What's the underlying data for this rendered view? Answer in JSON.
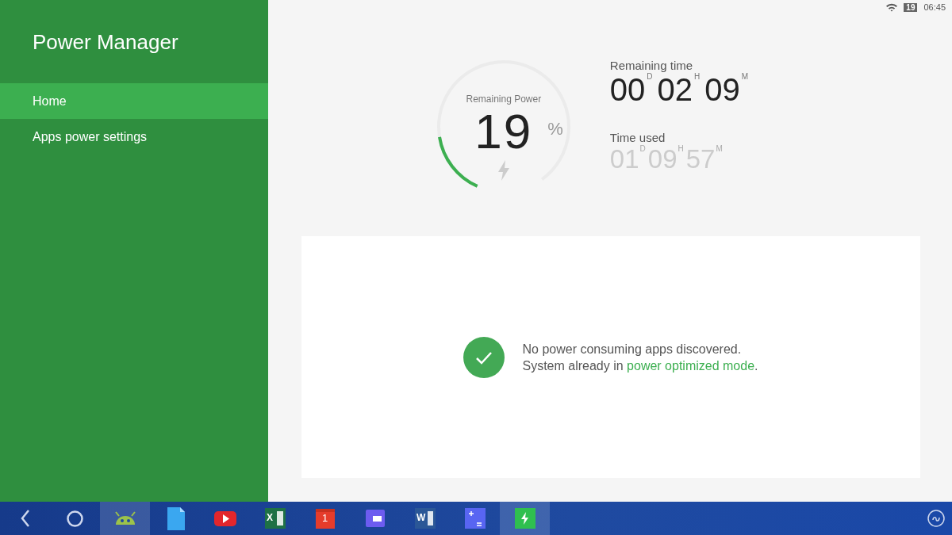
{
  "sidebar": {
    "title": "Power Manager",
    "items": [
      {
        "label": "Home",
        "selected": true
      },
      {
        "label": "Apps power settings",
        "selected": false
      }
    ]
  },
  "status_bar": {
    "battery": "19",
    "time": "06:45"
  },
  "gauge": {
    "label": "Remaining Power",
    "value": "19",
    "unit": "%",
    "level": 0.19
  },
  "remaining_time": {
    "label": "Remaining time",
    "parts": [
      {
        "value": "00",
        "unit": "D"
      },
      {
        "value": "02",
        "unit": "H"
      },
      {
        "value": "09",
        "unit": "M"
      }
    ]
  },
  "time_used": {
    "label": "Time used",
    "parts": [
      {
        "value": "01",
        "unit": "D"
      },
      {
        "value": "09",
        "unit": "H"
      },
      {
        "value": "57",
        "unit": "M"
      }
    ]
  },
  "message": {
    "line1": "No power consuming apps discovered.",
    "line2_before": "System already in ",
    "link": "power optimized mode",
    "line2_after": "."
  },
  "taskbar": {
    "items": [
      {
        "kind": "back",
        "selected": false
      },
      {
        "kind": "home",
        "selected": false
      },
      {
        "kind": "android",
        "selected": true
      },
      {
        "kind": "document",
        "selected": false
      },
      {
        "kind": "video",
        "selected": false
      },
      {
        "kind": "sheet",
        "label": "X",
        "selected": false
      },
      {
        "kind": "calendar",
        "label": "1",
        "selected": false
      },
      {
        "kind": "screen",
        "selected": false
      },
      {
        "kind": "word",
        "label": "W",
        "selected": false
      },
      {
        "kind": "calculator",
        "selected": false
      },
      {
        "kind": "power",
        "selected": true
      }
    ]
  }
}
